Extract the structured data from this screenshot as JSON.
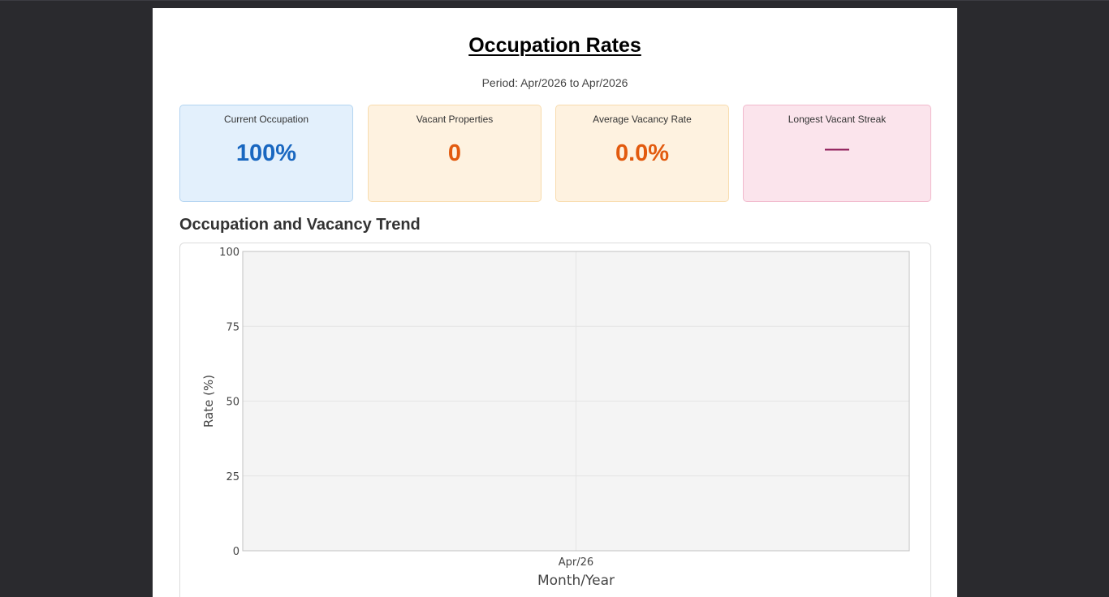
{
  "page": {
    "title": "Occupation Rates",
    "period": "Period: Apr/2026 to Apr/2026"
  },
  "cards": [
    {
      "label": "Current Occupation",
      "value": "100%"
    },
    {
      "label": "Vacant Properties",
      "value": "0"
    },
    {
      "label": "Average Vacancy Rate",
      "value": "0.0%"
    },
    {
      "label": "Longest Vacant Streak",
      "value": "—"
    }
  ],
  "section": {
    "title": "Occupation and Vacancy Trend"
  },
  "colors": {
    "occupation": "#1967c0",
    "vacancy": "#e25a0e",
    "streak": "#8b1654",
    "plot_background": "#f4f4f4"
  },
  "chart_data": {
    "type": "line",
    "categories": [
      "Apr/26"
    ],
    "series": [],
    "xlabel": "Month/Year",
    "ylabel": "Rate (%)",
    "ylim": [
      0,
      100
    ],
    "yticks": [
      0,
      25,
      50,
      75,
      100
    ],
    "grid": true
  }
}
